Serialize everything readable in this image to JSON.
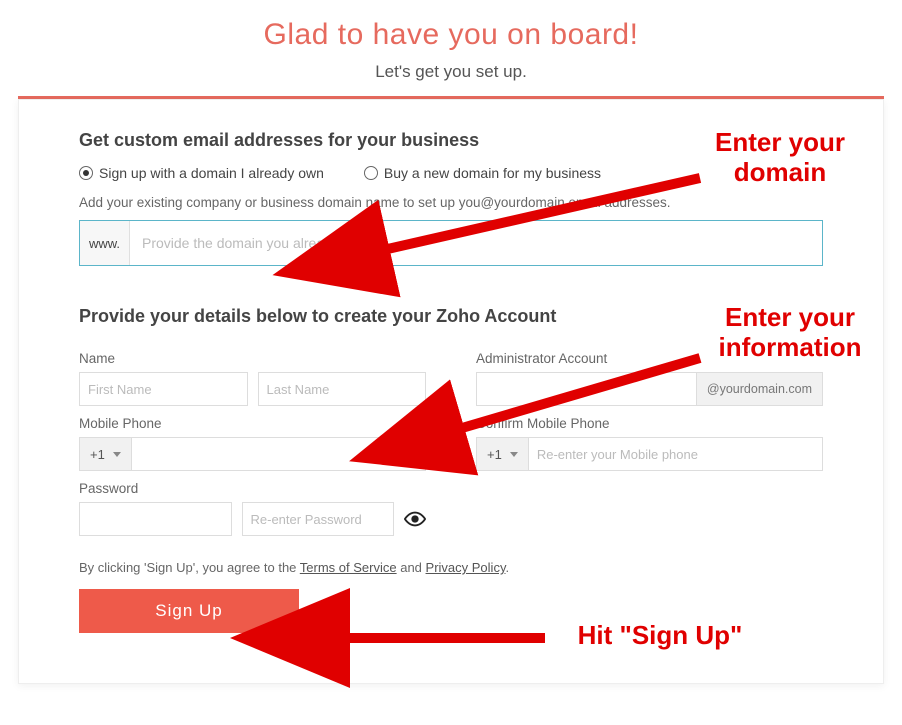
{
  "header": {
    "title": "Glad to have you on board!",
    "subtitle": "Let's get you set up."
  },
  "section1": {
    "heading": "Get custom email addresses for your business",
    "radio_own": "Sign up with a domain I already own",
    "radio_buy": "Buy a new domain for my business",
    "helper": "Add your existing company or business domain name to set up you@yourdomain email addresses.",
    "prefix": "www.",
    "domain_placeholder": "Provide the domain you already own"
  },
  "section2": {
    "heading": "Provide your details below to create your Zoho Account",
    "labels": {
      "name": "Name",
      "admin": "Administrator Account",
      "mobile": "Mobile Phone",
      "confirm_mobile": "Confirm Mobile Phone",
      "password": "Password"
    },
    "placeholders": {
      "first_name": "First Name",
      "last_name": "Last Name",
      "reenter_phone": "Re-enter your Mobile phone",
      "reenter_password": "Re-enter Password"
    },
    "admin_suffix": "@yourdomain.com",
    "phone_code": "+1"
  },
  "terms": {
    "prefix": "By clicking 'Sign Up', you agree to the ",
    "tos": "Terms of Service",
    "mid": " and ",
    "privacy": "Privacy Policy",
    "suffix": "."
  },
  "buttons": {
    "signup": "Sign Up"
  },
  "annotations": {
    "a1": "Enter your\ndomain",
    "a2": "Enter your\ninformation",
    "a3": "Hit \"Sign Up\""
  },
  "colors": {
    "accent": "#e66a5e",
    "button": "#ee5a4a",
    "annotation": "#e00000"
  }
}
